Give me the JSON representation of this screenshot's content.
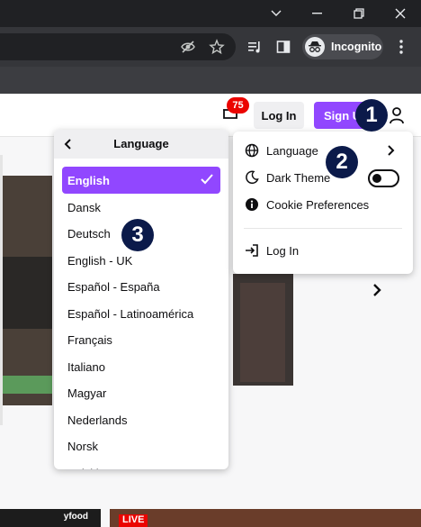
{
  "browser": {
    "incognito_label": "Incognito"
  },
  "header": {
    "login_label": "Log In",
    "signup_label": "Sign Up",
    "notification_count": "75"
  },
  "language_menu": {
    "title": "Language",
    "items": [
      {
        "label": "English",
        "selected": true
      },
      {
        "label": "Dansk"
      },
      {
        "label": "Deutsch"
      },
      {
        "label": "English - UK"
      },
      {
        "label": "Español - España"
      },
      {
        "label": "Español - Latinoamérica"
      },
      {
        "label": "Français"
      },
      {
        "label": "Italiano"
      },
      {
        "label": "Magyar"
      },
      {
        "label": "Nederlands"
      },
      {
        "label": "Norsk"
      },
      {
        "label": "Polski"
      }
    ]
  },
  "settings_menu": {
    "language_label": "Language",
    "dark_theme_label": "Dark Theme",
    "cookie_label": "Cookie Preferences",
    "login_label": "Log In",
    "dark_theme_on": false
  },
  "annotations": {
    "step1": "1",
    "step2": "2",
    "step3": "3"
  },
  "thumbnails": {
    "live_badge": "LIVE",
    "channel_fragment": "yfood"
  },
  "colors": {
    "accent": "#9147ff",
    "badge": "#eb0400",
    "annotation": "#0b1a4a"
  }
}
